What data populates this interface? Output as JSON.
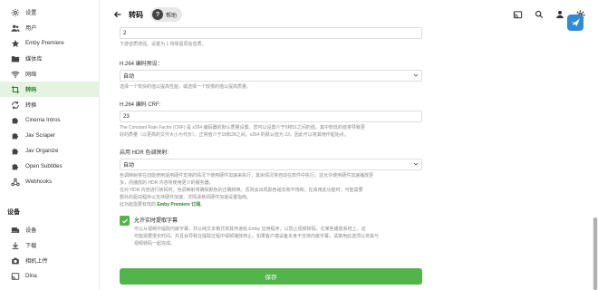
{
  "sidebar": {
    "items_top": [
      {
        "label": "设置",
        "icon": "gear-icon"
      },
      {
        "label": "用户",
        "icon": "people-icon"
      },
      {
        "label": "Emby Premiere",
        "icon": "star-icon"
      },
      {
        "label": "媒体库",
        "icon": "folder-icon"
      },
      {
        "label": "网络",
        "icon": "wifi-icon"
      },
      {
        "label": "转码",
        "icon": "crop-icon"
      },
      {
        "label": "转换",
        "icon": "sync-icon"
      },
      {
        "label": "Cinema Intros",
        "icon": "puzzle-icon"
      },
      {
        "label": "Jav Scraper",
        "icon": "puzzle-icon"
      },
      {
        "label": "Jav Organize",
        "icon": "puzzle-icon"
      },
      {
        "label": "Open Subtitles",
        "icon": "puzzle-icon"
      },
      {
        "label": "Webhooks",
        "icon": "webhook-icon"
      }
    ],
    "section_devices": "设备",
    "items_devices": [
      {
        "label": "设备",
        "icon": "devices-icon"
      },
      {
        "label": "下载",
        "icon": "download-icon"
      },
      {
        "label": "相机上传",
        "icon": "camera-icon"
      },
      {
        "label": "Dlna",
        "icon": "cast-icon"
      }
    ]
  },
  "header": {
    "title": "转码",
    "help_label": "帮助"
  },
  "form": {
    "threads_value": "2",
    "threads_desc": "下游音质增强。设置为 1 将保留原始音质。",
    "h264_preset_label": "H.264 编码预设：",
    "h264_preset_value": "自动",
    "h264_preset_desc": "选择一个较快的值以提高性能，或选择一个较慢的值以提高质量。",
    "crf_label": "H.264 编码 CRF:",
    "crf_value": "23",
    "crf_desc_1": "The Constant Rate Factor (CRF) 是 x264 编码器的默认质量设置。您可以设置介于0和51之间的值，其中较低的值将导致更",
    "crf_desc_2": "好的质量（以更高的文件大小为代价）。正常值介于18和28之间。x264 的默认值为 23，因此可以将其用作起始点。",
    "hdr_label": "启用 HDR 色调映射:",
    "hdr_value": "自动",
    "hdr_desc_1": "色调映射将在动能使用适用硬件支持的情况下使用硬件加速来执行，其余情况将自动在软件中执行。这允许使用硬件加速播放更",
    "hdr_desc_2": "多，而播放的 HDR 内容将使用更少的服务器。",
    "hdr_desc_3": "在对 HDR 内容进行转码时，色调映射将确保颜色的正确转换。否则会出现颜色褪去和不饱和。在启用此功能时，可能需要",
    "hdr_desc_4": "额外的驱动程序以支持硬件加速。详情请参阅硬件加速设置指南。",
    "hdr_desc_5_pre": "此功能需要有效的 ",
    "hdr_desc_5_link": "Emby Premiere 订阅",
    "hdr_desc_5_post": "。",
    "realtime_label": "允许实时提取字幕",
    "realtime_checked": true,
    "realtime_desc_1": "可以从视频中提取内嵌字幕，并以纯文本格式将其传递给 Emby 应用程序，以防止视频转码。在某些播放系统上，这",
    "realtime_desc_2": "可能需要很长时间，并且会导致在提取过程中视频播放停止。如果客户端设备本身不支持内嵌字幕，请禁用此选项以将其与",
    "realtime_desc_3": "视频转码一起完成。",
    "save_label": "保存"
  },
  "colors": {
    "accent": "#52b54b",
    "active_bg": "#e5f3e1",
    "active_text": "#2e7d32",
    "bird_bg": "#2f8bd8"
  }
}
